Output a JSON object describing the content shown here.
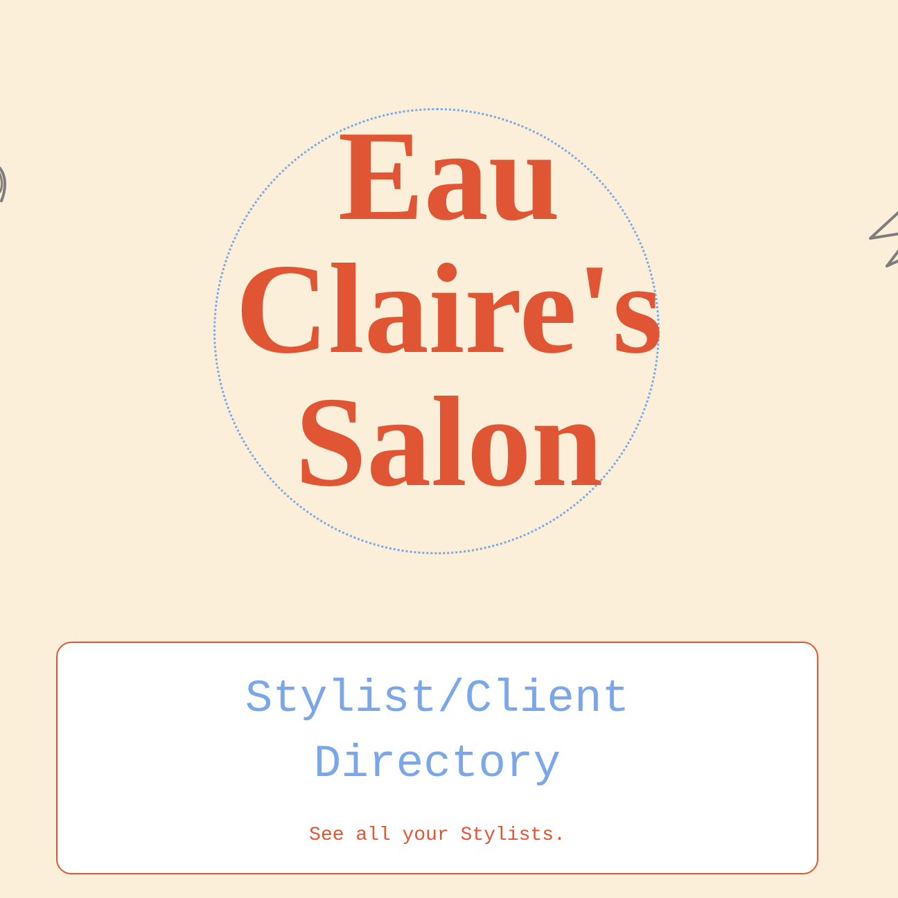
{
  "logo": {
    "line1": "Eau",
    "line2": "Claire's",
    "line3": "Salon"
  },
  "directory_card": {
    "title_line1": "Stylist/Client",
    "title_line2": "Directory",
    "subtitle": "See all your Stylists."
  },
  "colors": {
    "background": "#fcefd9",
    "accent": "#e05533",
    "highlight": "#7aa6ea",
    "card_background": "#ffffff",
    "decoration": "#7d7d7d"
  },
  "icons": {
    "left_decoration": "scissors-sketch-icon",
    "right_decoration": "comb-sketch-icon"
  }
}
